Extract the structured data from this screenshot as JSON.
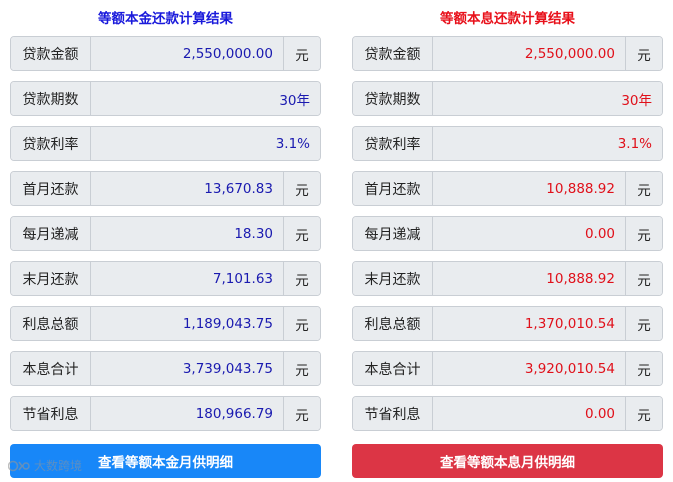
{
  "left": {
    "title": "等额本金还款计算结果",
    "rows": [
      {
        "label": "贷款金额",
        "value": "2,550,000.00",
        "unit": "元"
      },
      {
        "label": "贷款期数",
        "value": "30年",
        "unit": ""
      },
      {
        "label": "贷款利率",
        "value": "3.1%",
        "unit": ""
      },
      {
        "label": "首月还款",
        "value": "13,670.83",
        "unit": "元"
      },
      {
        "label": "每月递减",
        "value": "18.30",
        "unit": "元"
      },
      {
        "label": "末月还款",
        "value": "7,101.63",
        "unit": "元"
      },
      {
        "label": "利息总额",
        "value": "1,189,043.75",
        "unit": "元"
      },
      {
        "label": "本息合计",
        "value": "3,739,043.75",
        "unit": "元"
      },
      {
        "label": "节省利息",
        "value": "180,966.79",
        "unit": "元"
      }
    ],
    "button": "查看等额本金月供明细"
  },
  "right": {
    "title": "等额本息还款计算结果",
    "rows": [
      {
        "label": "贷款金额",
        "value": "2,550,000.00",
        "unit": "元"
      },
      {
        "label": "贷款期数",
        "value": "30年",
        "unit": ""
      },
      {
        "label": "贷款利率",
        "value": "3.1%",
        "unit": ""
      },
      {
        "label": "首月还款",
        "value": "10,888.92",
        "unit": "元"
      },
      {
        "label": "每月递减",
        "value": "0.00",
        "unit": "元"
      },
      {
        "label": "末月还款",
        "value": "10,888.92",
        "unit": "元"
      },
      {
        "label": "利息总额",
        "value": "1,370,010.54",
        "unit": "元"
      },
      {
        "label": "本息合计",
        "value": "3,920,010.54",
        "unit": "元"
      },
      {
        "label": "节省利息",
        "value": "0.00",
        "unit": "元"
      }
    ],
    "button": "查看等额本息月供明细"
  },
  "watermark": {
    "text": "大数跨境",
    "icon": "logo-icon"
  },
  "colors": {
    "left_accent": "#1a1adb",
    "right_accent": "#e8101a",
    "left_button": "#1887f8",
    "right_button": "#dc3545"
  }
}
